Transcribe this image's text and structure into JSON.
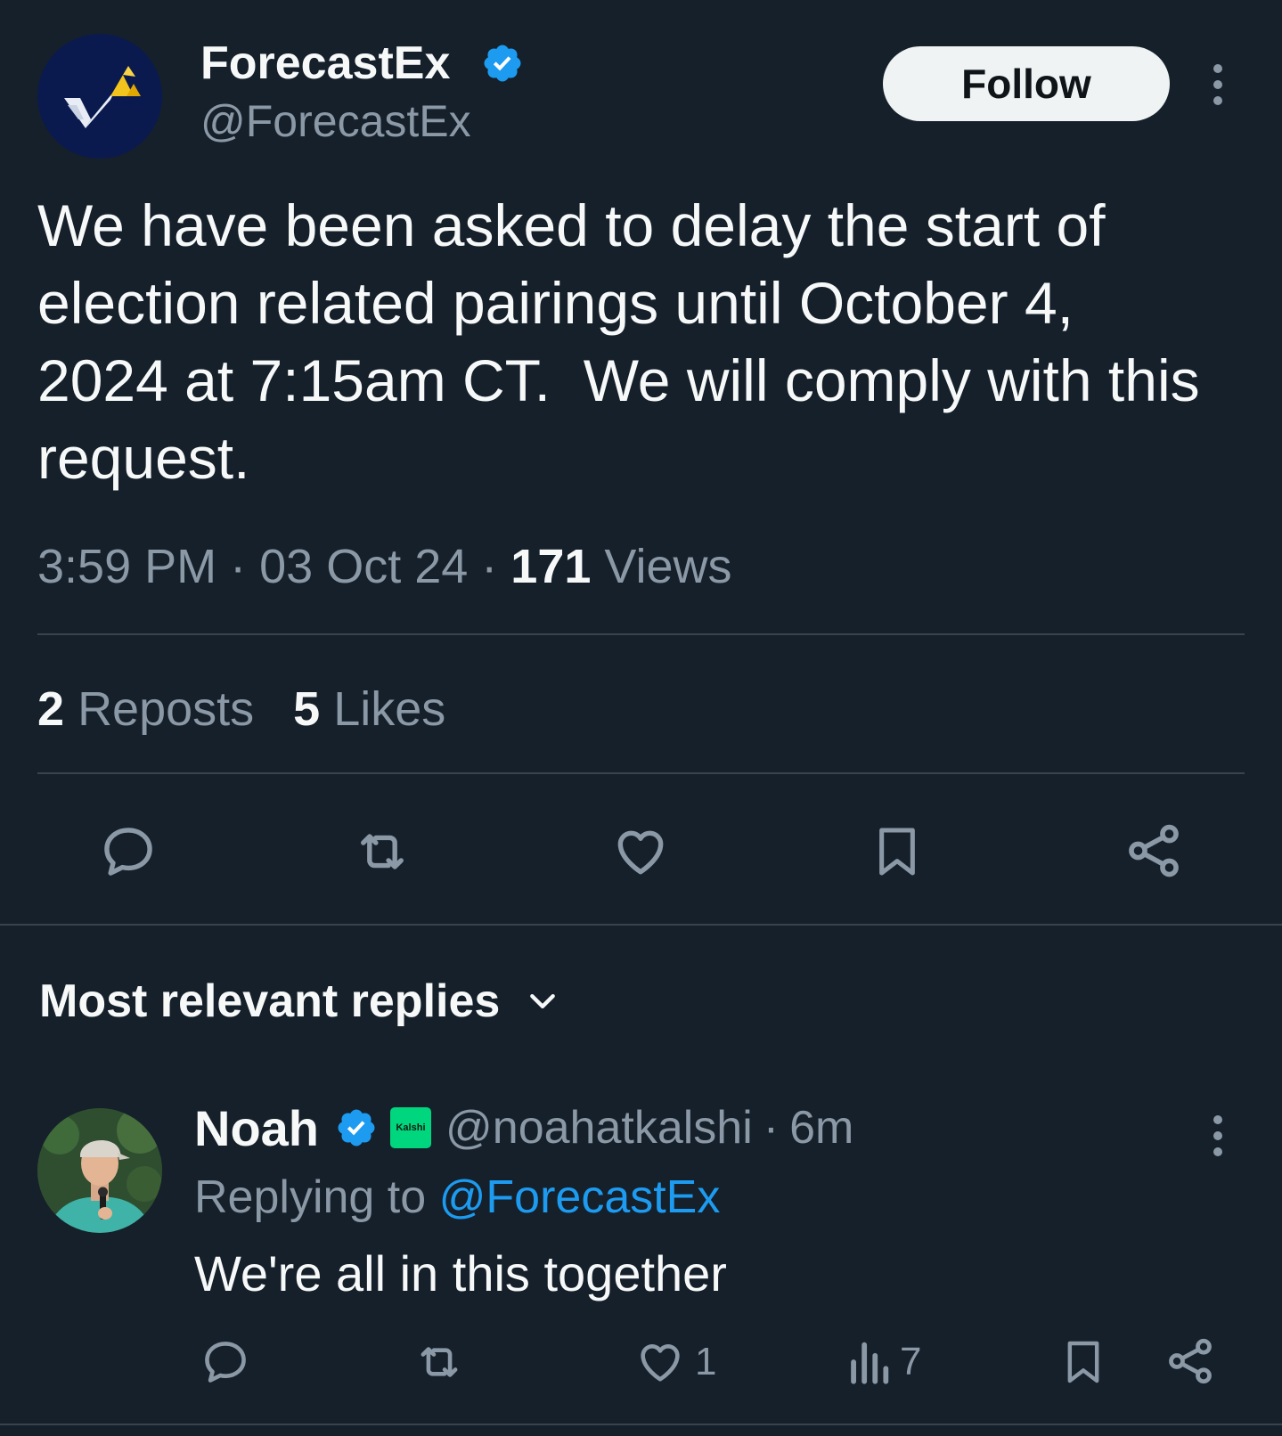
{
  "tweet": {
    "author": {
      "name": "ForecastEx",
      "handle": "@ForecastEx",
      "verified": true,
      "avatar_icon": "forecastex-logo-icon"
    },
    "follow_label": "Follow",
    "text": "We have been asked to delay the start of\nelection related pairings until October 4,\n2024 at 7:15am CT.  We will comply with this\nrequest.",
    "time": "3:59 PM",
    "date": "03 Oct 24",
    "views_count": "171",
    "views_label": "Views",
    "separator": "·",
    "reposts_count": "2",
    "reposts_label": "Reposts",
    "likes_count": "5",
    "likes_label": "Likes",
    "actions": [
      "reply-icon",
      "repost-icon",
      "like-icon",
      "bookmark-icon",
      "share-icon"
    ]
  },
  "replies": {
    "heading": "Most relevant replies",
    "items": [
      {
        "name": "Noah",
        "verified": true,
        "affiliate_badge": "Kalshi",
        "handle": "@noahatkalshi",
        "time": "6m",
        "separator": "·",
        "replying_prefix": "Replying to ",
        "replying_to": "@ForecastEx",
        "text": "We're all in this together",
        "likes": "1",
        "views": "7"
      }
    ]
  },
  "colors": {
    "background": "#15202b",
    "text_primary": "#f7f9f9",
    "text_secondary": "#8b98a5",
    "accent": "#1d9bf0",
    "divider": "#38444d",
    "kalshi_green": "#00d67d"
  }
}
